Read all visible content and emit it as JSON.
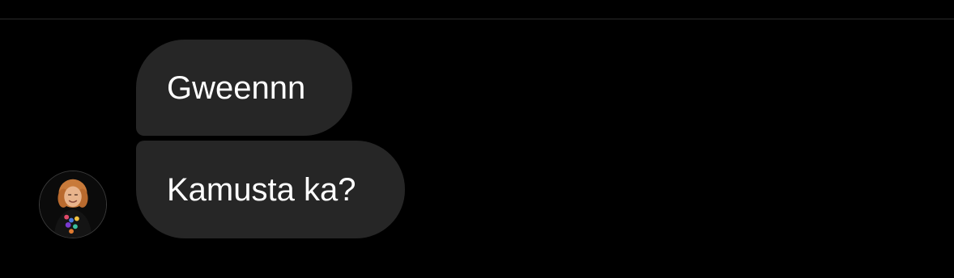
{
  "messages": [
    {
      "sender": "other",
      "text": "Gweennn"
    },
    {
      "sender": "other",
      "text": "Kamusta ka?"
    }
  ],
  "avatar": {
    "icon": "profile-photo"
  },
  "colors": {
    "background": "#000000",
    "incoming_bubble": "#262626",
    "text": "#ffffff",
    "divider": "#2a2a2a"
  }
}
